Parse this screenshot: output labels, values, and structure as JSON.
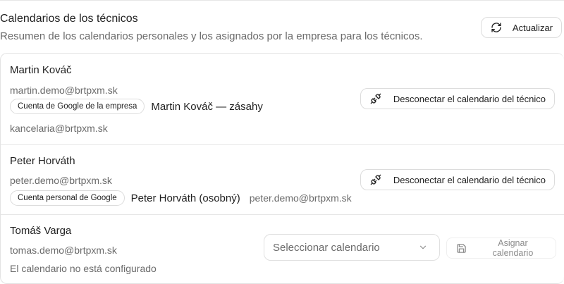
{
  "header": {
    "title": "Calendarios de los técnicos",
    "subtitle": "Resumen de los calendarios personales y los asignados por la empresa para los técnicos.",
    "refresh_label": "Actualizar"
  },
  "technicians": [
    {
      "name": "Martin Kováč",
      "email": "martin.demo@brtpxm.sk",
      "calendar_type": "Cuenta de Google de la empresa",
      "calendar_name": "Martin Kováč — zásahy",
      "calendar_account": "kancelaria@brtpxm.sk",
      "action_label": "Desconectar el calendario del técnico"
    },
    {
      "name": "Peter Horváth",
      "email": "peter.demo@brtpxm.sk",
      "calendar_type": "Cuenta personal de Google",
      "calendar_name": "Peter Horváth (osobný)",
      "calendar_account": "peter.demo@brtpxm.sk",
      "action_label": "Desconectar el calendario del técnico"
    },
    {
      "name": "Tomáš Varga",
      "email": "tomas.demo@brtpxm.sk",
      "status": "El calendario no está configurado",
      "select_placeholder": "Seleccionar calendario",
      "assign_label": "Asignar calendario"
    }
  ],
  "icons": {
    "refresh": "refresh-icon",
    "disconnect": "unplug-icon",
    "chevron": "chevron-down-icon",
    "save": "save-icon"
  }
}
